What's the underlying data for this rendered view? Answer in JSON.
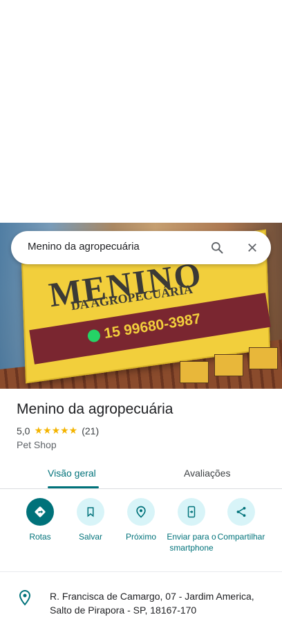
{
  "search": {
    "query": "Menino da agropecuária"
  },
  "photo": {
    "sign_title": "MENINO",
    "sign_subtitle": "DA AGROPECUÁRIA",
    "sign_phone": "15 99680-3987"
  },
  "place": {
    "name": "Menino da agropecuária",
    "rating": "5,0",
    "stars": "★★★★★",
    "review_count": "(21)",
    "category": "Pet Shop"
  },
  "tabs": [
    {
      "label": "Visão geral"
    },
    {
      "label": "Avaliações"
    }
  ],
  "actions": [
    {
      "label": "Rotas",
      "icon": "directions-icon"
    },
    {
      "label": "Salvar",
      "icon": "bookmark-icon"
    },
    {
      "label": "Próximo",
      "icon": "nearby-icon"
    },
    {
      "label": "Enviar para o smartphone",
      "icon": "send-to-phone-icon"
    },
    {
      "label": "Compartilhar",
      "icon": "share-icon"
    }
  ],
  "address": {
    "text": "R. Francisca de Camargo, 07 - Jardim America, Salto de Pirapora - SP, 18167-170"
  },
  "colors": {
    "accent": "#00727a",
    "accent_light": "#d8f4f8",
    "star": "#f4b400"
  }
}
